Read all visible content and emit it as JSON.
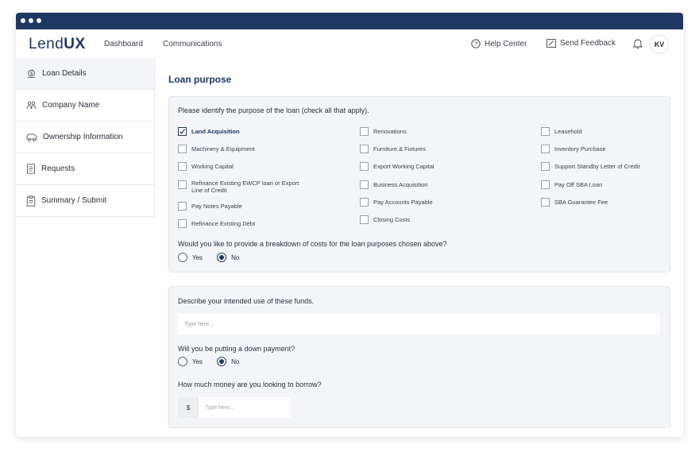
{
  "app": {
    "logo_light": "Lend",
    "logo_bold": "UX"
  },
  "topnav": {
    "links": [
      "Dashboard",
      "Communications"
    ],
    "help_label": "Help Center",
    "feedback_label": "Send Feedback",
    "avatar_initials": "KV"
  },
  "sidebar": {
    "items": [
      {
        "label": "Loan Details",
        "icon": "money-bag-icon"
      },
      {
        "label": "Company Name",
        "icon": "people-icon"
      },
      {
        "label": "Ownership Information",
        "icon": "car-icon"
      },
      {
        "label": "Requests",
        "icon": "document-icon"
      },
      {
        "label": "Summary / Submit",
        "icon": "clipboard-icon"
      }
    ]
  },
  "main": {
    "title": "Loan purpose",
    "purpose_question": "Please identify the purpose of the loan (check all that apply).",
    "options": [
      {
        "label": "Land Acquisition",
        "checked": true
      },
      {
        "label": "Machinery & Equipment",
        "checked": false
      },
      {
        "label": "Working Capital",
        "checked": false
      },
      {
        "label": "Refinance Existing EWCP loan or Export Line of Credit",
        "checked": false
      },
      {
        "label": "Pay Notes Payable",
        "checked": false
      },
      {
        "label": "Refinance Existing Debt",
        "checked": false
      },
      {
        "label": "Renovations",
        "checked": false
      },
      {
        "label": "Furniture & Fixtures",
        "checked": false
      },
      {
        "label": "Export Working Capital",
        "checked": false
      },
      {
        "label": "Business Acquisition",
        "checked": false
      },
      {
        "label": "Pay Accounts Payable",
        "checked": false
      },
      {
        "label": "Closing Costs",
        "checked": false
      },
      {
        "label": "Leasehold",
        "checked": false
      },
      {
        "label": "Inventory Purchase",
        "checked": false
      },
      {
        "label": "Support Standby Letter of Credit",
        "checked": false
      },
      {
        "label": "Pay Off SBA Loan",
        "checked": false
      },
      {
        "label": "SBA Guarantee Fee",
        "checked": false
      }
    ],
    "breakdown_question": "Would you like to provide a breakdown of costs for the loan purposes chosen above?",
    "breakdown_answer": "No",
    "yes_label": "Yes",
    "no_label": "No",
    "funds_question": "Describe your intended use of these funds.",
    "funds_placeholder": "Type here...",
    "down_payment_question": "Will you be putting a down payment?",
    "down_payment_answer": "No",
    "borrow_question": "How much money are you looking to borrow?",
    "currency_symbol": "$",
    "borrow_placeholder": "Type here..."
  },
  "colors": {
    "brand": "#1f3763",
    "panel": "#f4f5f8"
  }
}
